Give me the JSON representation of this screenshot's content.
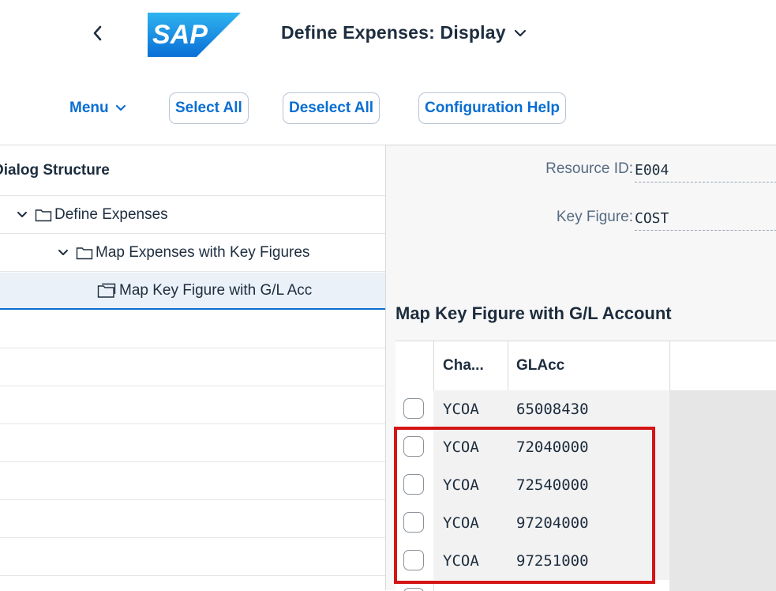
{
  "shell": {
    "title": "Define Expenses: Display",
    "logo_text": "SAP",
    "colors": {
      "brand_blue": "#0a6ed1",
      "text": "#1d2d3e",
      "highlight_red": "#d31515"
    }
  },
  "toolbar": {
    "menu_label": "Menu",
    "select_all_label": "Select All",
    "deselect_all_label": "Deselect All",
    "config_help_label": "Configuration Help"
  },
  "dialog_structure": {
    "header": "Dialog Structure",
    "items": [
      {
        "label": "Define Expenses",
        "icon": "folder-open-icon"
      },
      {
        "label": "Map Expenses with Key Figures",
        "icon": "folder-open-icon"
      },
      {
        "label": "Map Key Figure with G/L Acc",
        "icon": "folder-page-icon",
        "selected": true
      }
    ]
  },
  "detail": {
    "resource_id_label": "Resource ID:",
    "resource_id_value": "E004",
    "key_figure_label": "Key Figure:",
    "key_figure_value": "COST",
    "section_title": "Map Key Figure with G/L Account",
    "table": {
      "headers": [
        "Cha...",
        "GLAcc"
      ],
      "rows": [
        {
          "chart": "YCOA",
          "glacc": "65008430"
        },
        {
          "chart": "YCOA",
          "glacc": "72040000"
        },
        {
          "chart": "YCOA",
          "glacc": "72540000"
        },
        {
          "chart": "YCOA",
          "glacc": "97204000"
        },
        {
          "chart": "YCOA",
          "glacc": "97251000"
        }
      ]
    }
  }
}
